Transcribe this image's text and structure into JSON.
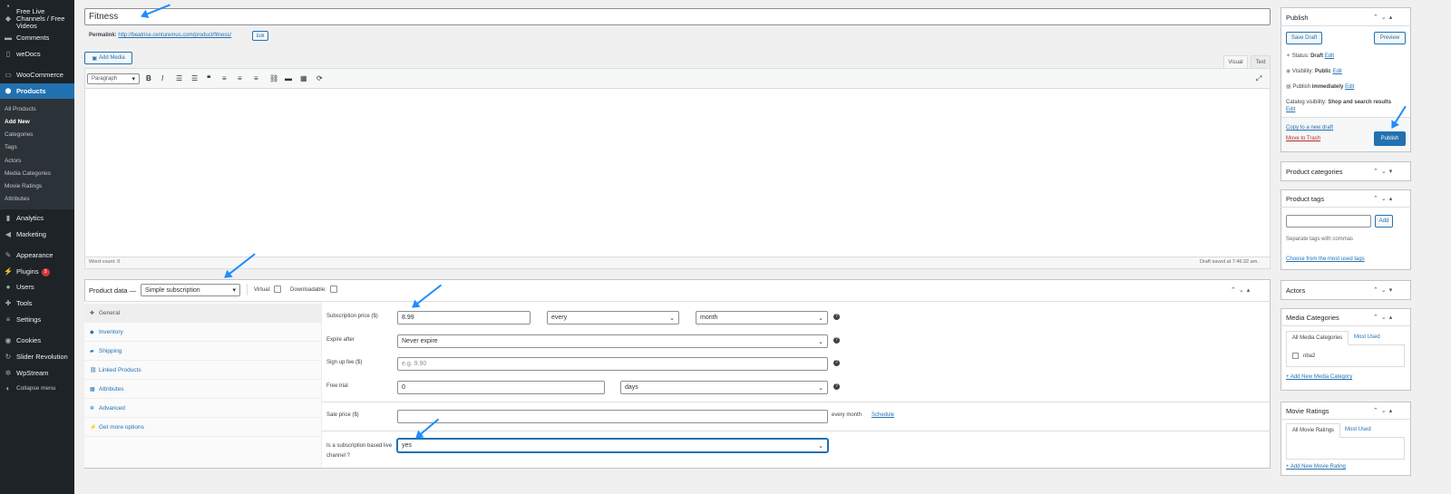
{
  "sidebar": {
    "items": [
      {
        "label": "Free Live Channels / Free Videos",
        "icon": "tag-icon"
      },
      {
        "label": "Comments",
        "icon": "comment-icon"
      },
      {
        "label": "weDocs",
        "icon": "document-icon"
      },
      {
        "label": "WooCommerce",
        "icon": "woo-icon"
      },
      {
        "label": "Products",
        "icon": "cube-icon"
      },
      {
        "label": "Analytics",
        "icon": "bar-chart-icon"
      },
      {
        "label": "Marketing",
        "icon": "megaphone-icon"
      },
      {
        "label": "Appearance",
        "icon": "brush-icon"
      },
      {
        "label": "Plugins",
        "icon": "plug-icon",
        "badge": "3"
      },
      {
        "label": "Users",
        "icon": "user-icon"
      },
      {
        "label": "Tools",
        "icon": "wrench-icon"
      },
      {
        "label": "Settings",
        "icon": "sliders-icon"
      },
      {
        "label": "Cookies",
        "icon": "cookie-icon"
      },
      {
        "label": "Slider Revolution",
        "icon": "refresh-icon"
      },
      {
        "label": "WpStream",
        "icon": "gear-icon"
      },
      {
        "label": "Collapse menu",
        "icon": "collapse-icon"
      }
    ],
    "products_sub": [
      "All Products",
      "Add New",
      "Categories",
      "Tags",
      "Actors",
      "Media Categories",
      "Movie Ratings",
      "Attributes"
    ]
  },
  "post": {
    "title": "Fitness",
    "permalink_label": "Permalink:",
    "permalink_url": "http://beatrice.centuremus.com/product/fitness/",
    "edit_label": "Edit",
    "add_media": "Add Media",
    "visual_tab": "Visual",
    "text_tab": "Text",
    "format_select": "Paragraph",
    "word_count": "Word count: 0",
    "draft_saved": "Draft saved at 7:46:32 am."
  },
  "product_data": {
    "label": "Product data —",
    "type": "Simple subscription",
    "virtual_label": "Virtual:",
    "downloadable_label": "Downloadable:",
    "tabs": [
      "General",
      "Inventory",
      "Shipping",
      "Linked Products",
      "Attributes",
      "Advanced",
      "Get more options"
    ],
    "fields": {
      "sub_price_label": "Subscription price ($)",
      "sub_price_value": "8.99",
      "period_every": "every",
      "period_unit": "month",
      "expire_label": "Expire after",
      "expire_value": "Never expire",
      "signup_label": "Sign up fee ($)",
      "signup_placeholder": "e.g. 9.90",
      "trial_label": "Free trial",
      "trial_value": "0",
      "trial_unit": "days",
      "sale_label": "Sale price ($)",
      "sale_suffix": "every month",
      "schedule_link": "Schedule",
      "live_label": "Is a subscription based live channel ?",
      "live_value": "yes"
    }
  },
  "publish": {
    "title": "Publish",
    "save_draft": "Save Draft",
    "preview": "Preview",
    "status_label": "Status:",
    "status_value": "Draft",
    "visibility_label": "Visibility:",
    "visibility_value": "Public",
    "publish_label": "Publish",
    "publish_value": "immediately",
    "edit": "Edit",
    "catalog_label": "Catalog visibility:",
    "catalog_value": "Shop and search results",
    "copy_draft": "Copy to a new draft",
    "trash": "Move to Trash",
    "publish_button": "Publish"
  },
  "boxes": {
    "product_categories": "Product categories",
    "product_tags": "Product tags",
    "add_tag": "Add",
    "tags_help": "Separate tags with commas",
    "tags_choose": "Choose from the most used tags",
    "actors": "Actors",
    "media_categories": "Media Categories",
    "media_tab_all": "All Media Categories",
    "media_tab_most": "Most Used",
    "media_item": "nba2",
    "media_add": "+ Add New Media Category",
    "movie_ratings": "Movie Ratings",
    "ratings_tab_all": "All Movie Ratings",
    "ratings_tab_most": "Most Used",
    "ratings_add": "+ Add New Movie Rating"
  },
  "colors": {
    "accent": "#2271b1",
    "sidebar": "#1d2327",
    "annotation_arrow": "#1e8cff"
  }
}
